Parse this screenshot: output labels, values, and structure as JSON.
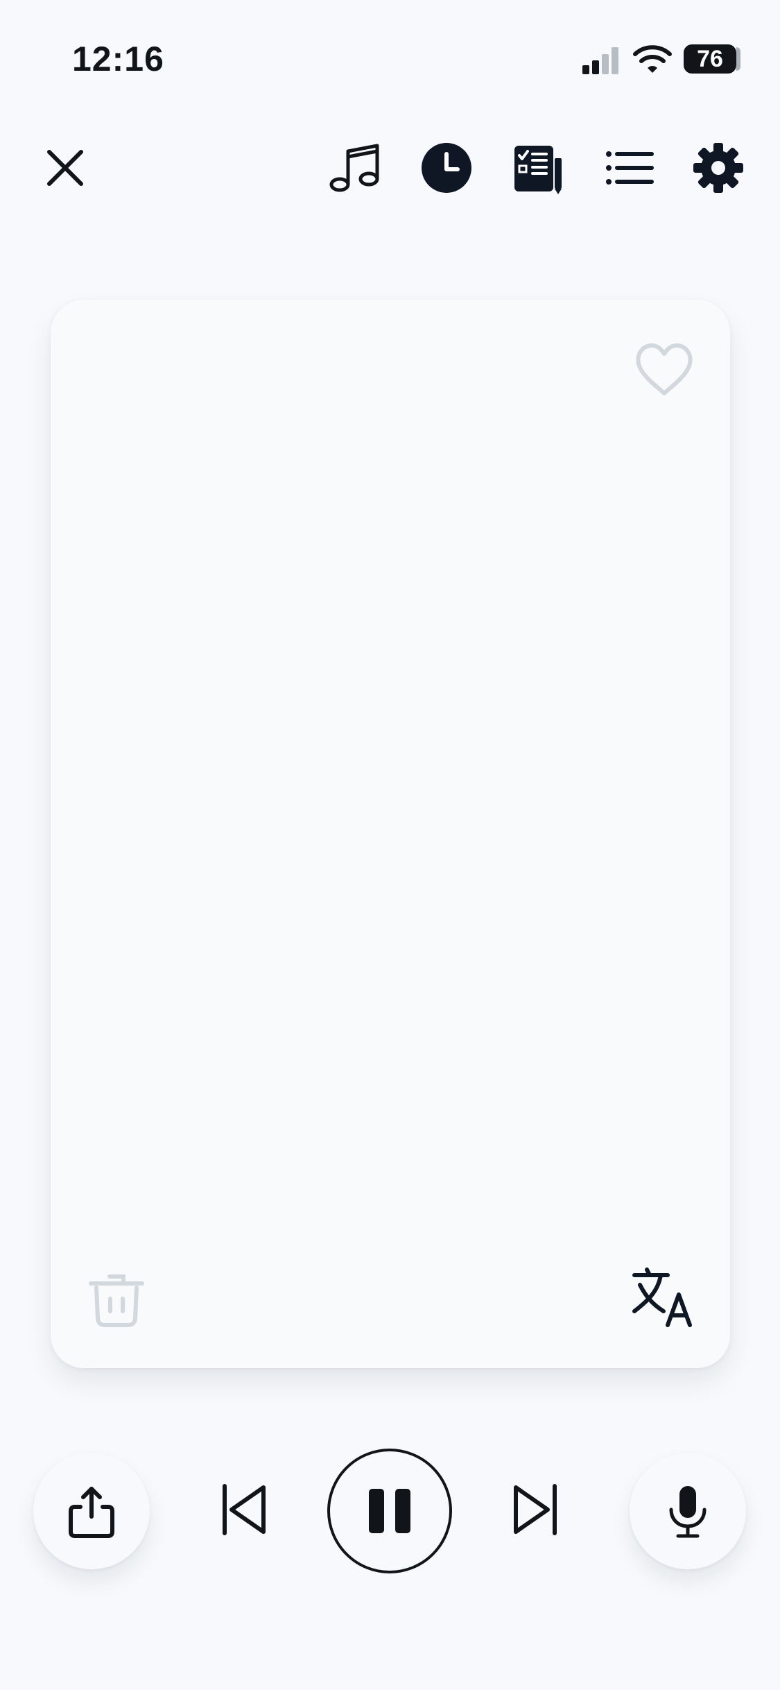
{
  "status_bar": {
    "time": "12:16",
    "battery": "76"
  },
  "toolbar": {
    "close_icon": "close-icon",
    "music_icon": "music-note-icon",
    "timer_icon": "clock-icon",
    "transcript_icon": "document-checklist-icon",
    "list_icon": "list-icon",
    "settings_icon": "gear-icon"
  },
  "card": {
    "favorite_icon": "heart-icon",
    "delete_icon": "trash-icon",
    "translate_icon": "translate-icon"
  },
  "controls": {
    "share_icon": "share-icon",
    "previous_icon": "skip-back-icon",
    "pause_icon": "pause-icon",
    "next_icon": "skip-forward-icon",
    "microphone_icon": "microphone-icon"
  },
  "colors": {
    "background": "#f7f9fc",
    "primary": "#0f1624",
    "muted_icon": "#d3d7de"
  }
}
